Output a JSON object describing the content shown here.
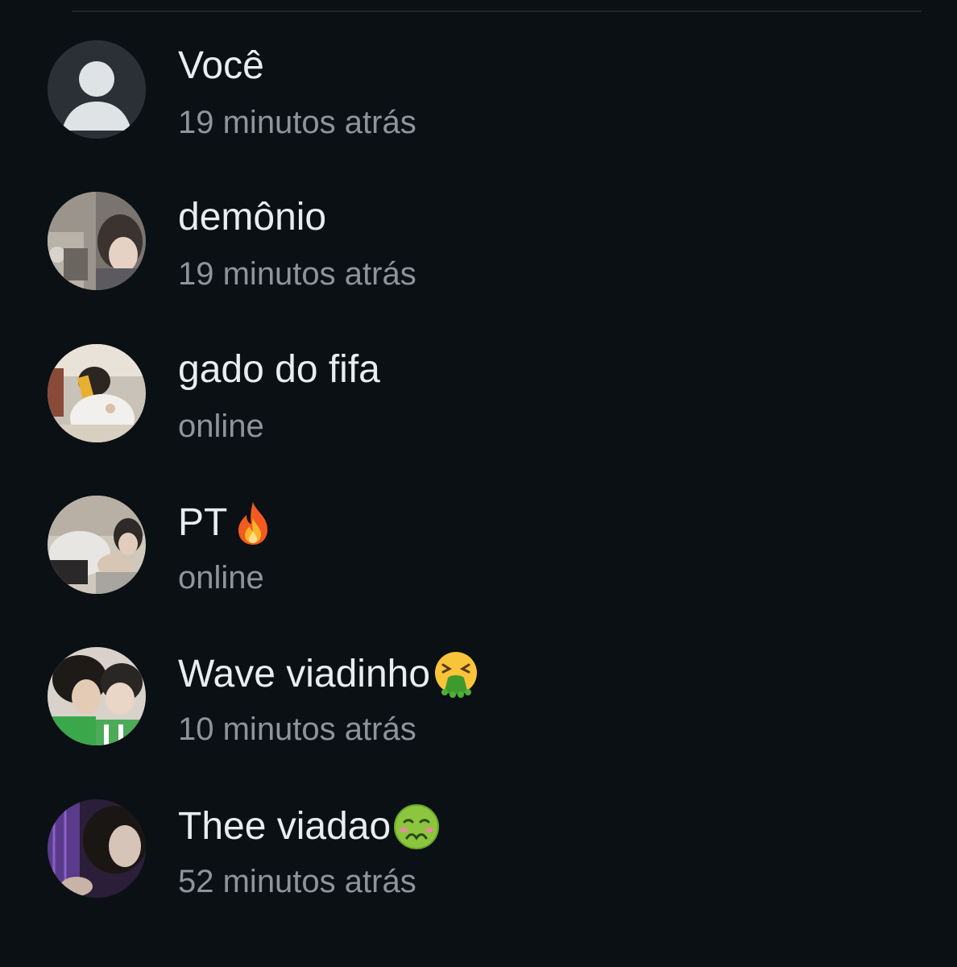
{
  "contacts": [
    {
      "name": "Você",
      "status": "19 minutos atrás",
      "avatar": "default-person-icon"
    },
    {
      "name": "demônio",
      "status": "19 minutos atrás",
      "avatar": "profile-photo"
    },
    {
      "name": "gado do fifa",
      "status": "online",
      "avatar": "profile-photo"
    },
    {
      "name": "PT",
      "emoji": "fire-emoji",
      "status": "online",
      "avatar": "profile-photo"
    },
    {
      "name": "Wave viadinho",
      "emoji": "vomiting-face-emoji",
      "status": "10 minutos atrás",
      "avatar": "profile-photo"
    },
    {
      "name": "Thee viadao",
      "emoji": "nauseated-face-emoji",
      "status": "52 minutos atrás",
      "avatar": "profile-photo"
    }
  ],
  "colors": {
    "background": "#0b1014",
    "name_text": "#e9edef",
    "status_text": "#8d959b",
    "default_avatar_bg": "#2a3035",
    "default_avatar_fg": "#dfe3e6"
  }
}
